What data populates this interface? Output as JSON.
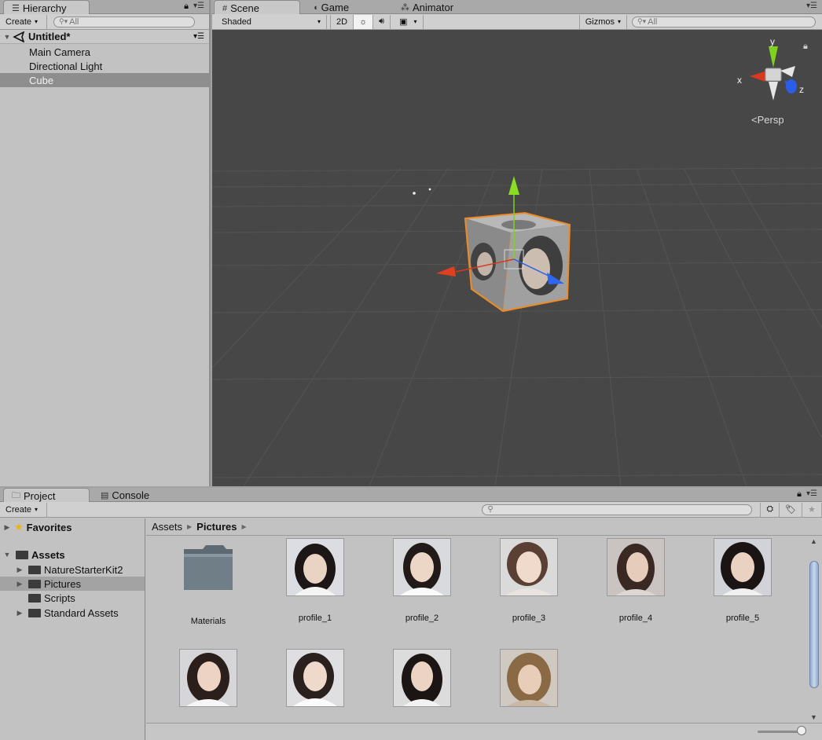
{
  "hierarchy": {
    "tab_label": "Hierarchy",
    "create_label": "Create",
    "search_placeholder": "All",
    "scene_name": "Untitled*",
    "items": [
      {
        "label": "Main Camera"
      },
      {
        "label": "Directional Light"
      },
      {
        "label": "Cube",
        "selected": true
      }
    ]
  },
  "scene_view": {
    "tabs": [
      {
        "label": "Scene",
        "icon": "grid-icon",
        "active": true
      },
      {
        "label": "Game",
        "icon": "pacman-icon"
      },
      {
        "label": "Animator",
        "icon": "animator-icon"
      }
    ],
    "shading_mode": "Shaded",
    "mode_2d_label": "2D",
    "gizmos_label": "Gizmos",
    "search_placeholder": "All",
    "gizmo_axes": {
      "x": "x",
      "y": "y",
      "z": "z"
    },
    "projection_label": "Persp",
    "colors": {
      "x_axis": "#d8391d",
      "y_axis": "#7fd21c",
      "z_axis": "#2a5ee8",
      "selection": "#f08a24"
    }
  },
  "project": {
    "tabs": [
      {
        "label": "Project",
        "icon": "folder-icon",
        "active": true
      },
      {
        "label": "Console",
        "icon": "console-icon"
      }
    ],
    "create_label": "Create",
    "favorites_label": "Favorites",
    "assets_label": "Assets",
    "folders": [
      {
        "label": "NatureStarterKit2",
        "expandable": true
      },
      {
        "label": "Pictures",
        "expandable": true,
        "selected": true
      },
      {
        "label": "Scripts",
        "expandable": false
      },
      {
        "label": "Standard Assets",
        "expandable": true
      }
    ],
    "breadcrumb": [
      "Assets",
      "Pictures"
    ],
    "items": [
      {
        "label": "Materials",
        "kind": "folder"
      },
      {
        "label": "profile_1",
        "kind": "image"
      },
      {
        "label": "profile_2",
        "kind": "image"
      },
      {
        "label": "profile_3",
        "kind": "image"
      },
      {
        "label": "profile_4",
        "kind": "image"
      },
      {
        "label": "profile_5",
        "kind": "image"
      },
      {
        "label": "",
        "kind": "image"
      },
      {
        "label": "",
        "kind": "image"
      },
      {
        "label": "",
        "kind": "image"
      },
      {
        "label": "",
        "kind": "image"
      }
    ]
  }
}
